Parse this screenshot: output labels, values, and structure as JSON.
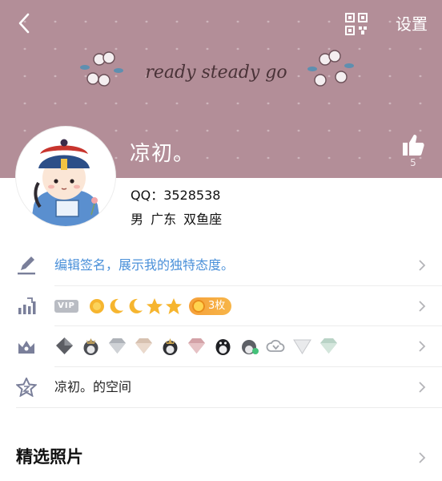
{
  "header": {
    "back_icon": "chevron-left-icon",
    "qr_icon": "qr-code-icon",
    "settings_label": "设置",
    "banner_color": "#b38e98",
    "banner_text": "ready steady go"
  },
  "profile": {
    "nickname": "凉初。",
    "like_count": "5",
    "qq_label": "QQ：3528538",
    "details": "男  广东  双鱼座"
  },
  "rows": {
    "signature": {
      "icon": "pencil-icon",
      "text": "编辑签名，展示我的独特态度。",
      "color": "#4a90d9"
    },
    "vip": {
      "icon": "level-chart-icon",
      "vip_tag": "VIP",
      "levels": [
        "sun",
        "moon",
        "moon",
        "star",
        "star"
      ],
      "badge_text": "3枚"
    },
    "medals": {
      "icon": "crown-icon",
      "items": [
        "gem-dark",
        "penguin-crown",
        "gem-silver",
        "gem-beige",
        "penguin-king",
        "gem-pink",
        "penguin-black",
        "penguin-green",
        "cloud-v",
        "gem-white",
        "gem-mint"
      ]
    },
    "space": {
      "icon": "star-z-icon",
      "text": "凉初。的空间"
    }
  },
  "photos": {
    "title": "精选照片"
  }
}
